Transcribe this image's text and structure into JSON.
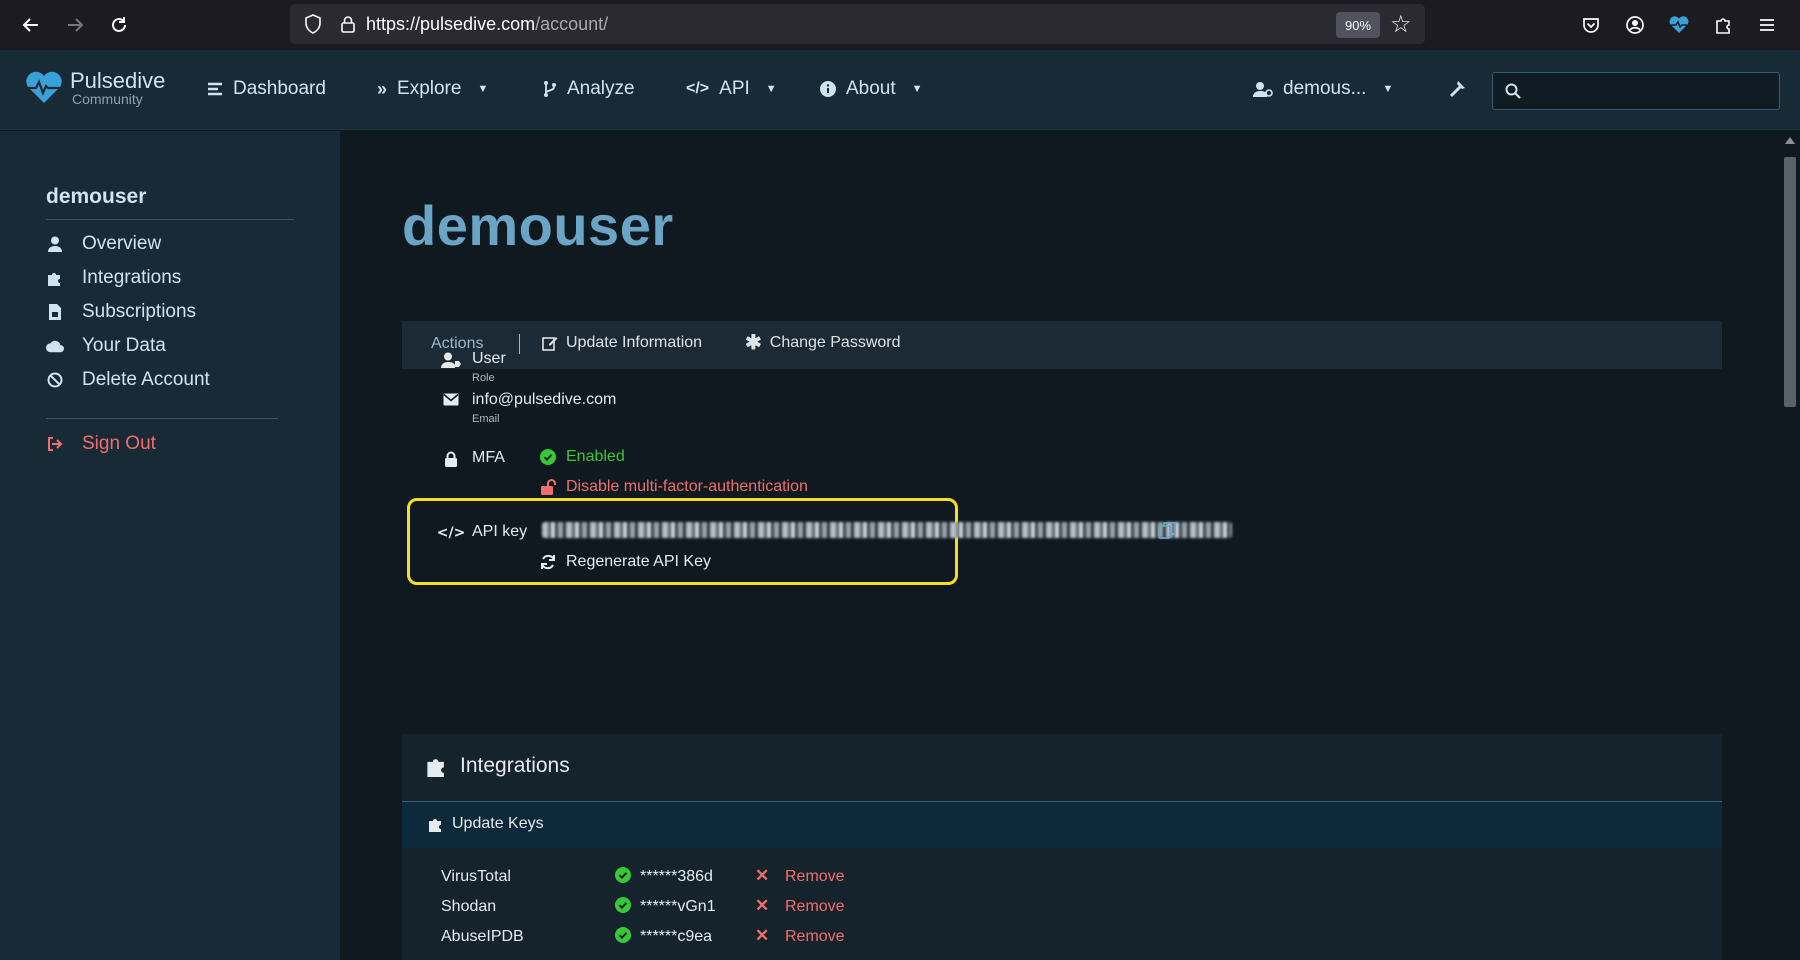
{
  "browser": {
    "url_host": "https://pulsedive.com",
    "url_path": "/account/",
    "zoom": "90%"
  },
  "site": {
    "logo_title": "Pulsedive",
    "logo_sub": "Community",
    "nav": {
      "dashboard": "Dashboard",
      "explore": "Explore",
      "analyze": "Analyze",
      "api": "API",
      "about": "About",
      "user": "demous..."
    },
    "search_placeholder": ""
  },
  "sidebar": {
    "username": "demouser",
    "items": [
      {
        "label": "Overview",
        "icon": "user-icon"
      },
      {
        "label": "Integrations",
        "icon": "puzzle-icon"
      },
      {
        "label": "Subscriptions",
        "icon": "file-invoice-icon"
      },
      {
        "label": "Your Data",
        "icon": "cloud-icon"
      },
      {
        "label": "Delete Account",
        "icon": "ban-icon"
      }
    ],
    "signout": "Sign Out"
  },
  "main": {
    "title": "demouser",
    "actions": {
      "label": "Actions",
      "update_info": "Update Information",
      "change_password": "Change Password"
    },
    "role": {
      "value": "User",
      "label": "Role"
    },
    "email": {
      "value": "info@pulsedive.com",
      "label": "Email"
    },
    "mfa": {
      "label": "MFA",
      "status": "Enabled",
      "disable": "Disable multi-factor-authentication"
    },
    "api_key": {
      "label": "API key",
      "regenerate": "Regenerate API Key"
    },
    "integrations": {
      "title": "Integrations",
      "update_keys": "Update Keys",
      "rows": [
        {
          "name": "VirusTotal",
          "key": "******386d",
          "remove": "Remove"
        },
        {
          "name": "Shodan",
          "key": "******vGn1",
          "remove": "Remove"
        },
        {
          "name": "AbuseIPDB",
          "key": "******c9ea",
          "remove": "Remove"
        }
      ]
    }
  },
  "colors": {
    "accent": "#6aa5c6",
    "success": "#37c837",
    "danger": "#f26d6d",
    "highlight": "#f5e11b"
  }
}
